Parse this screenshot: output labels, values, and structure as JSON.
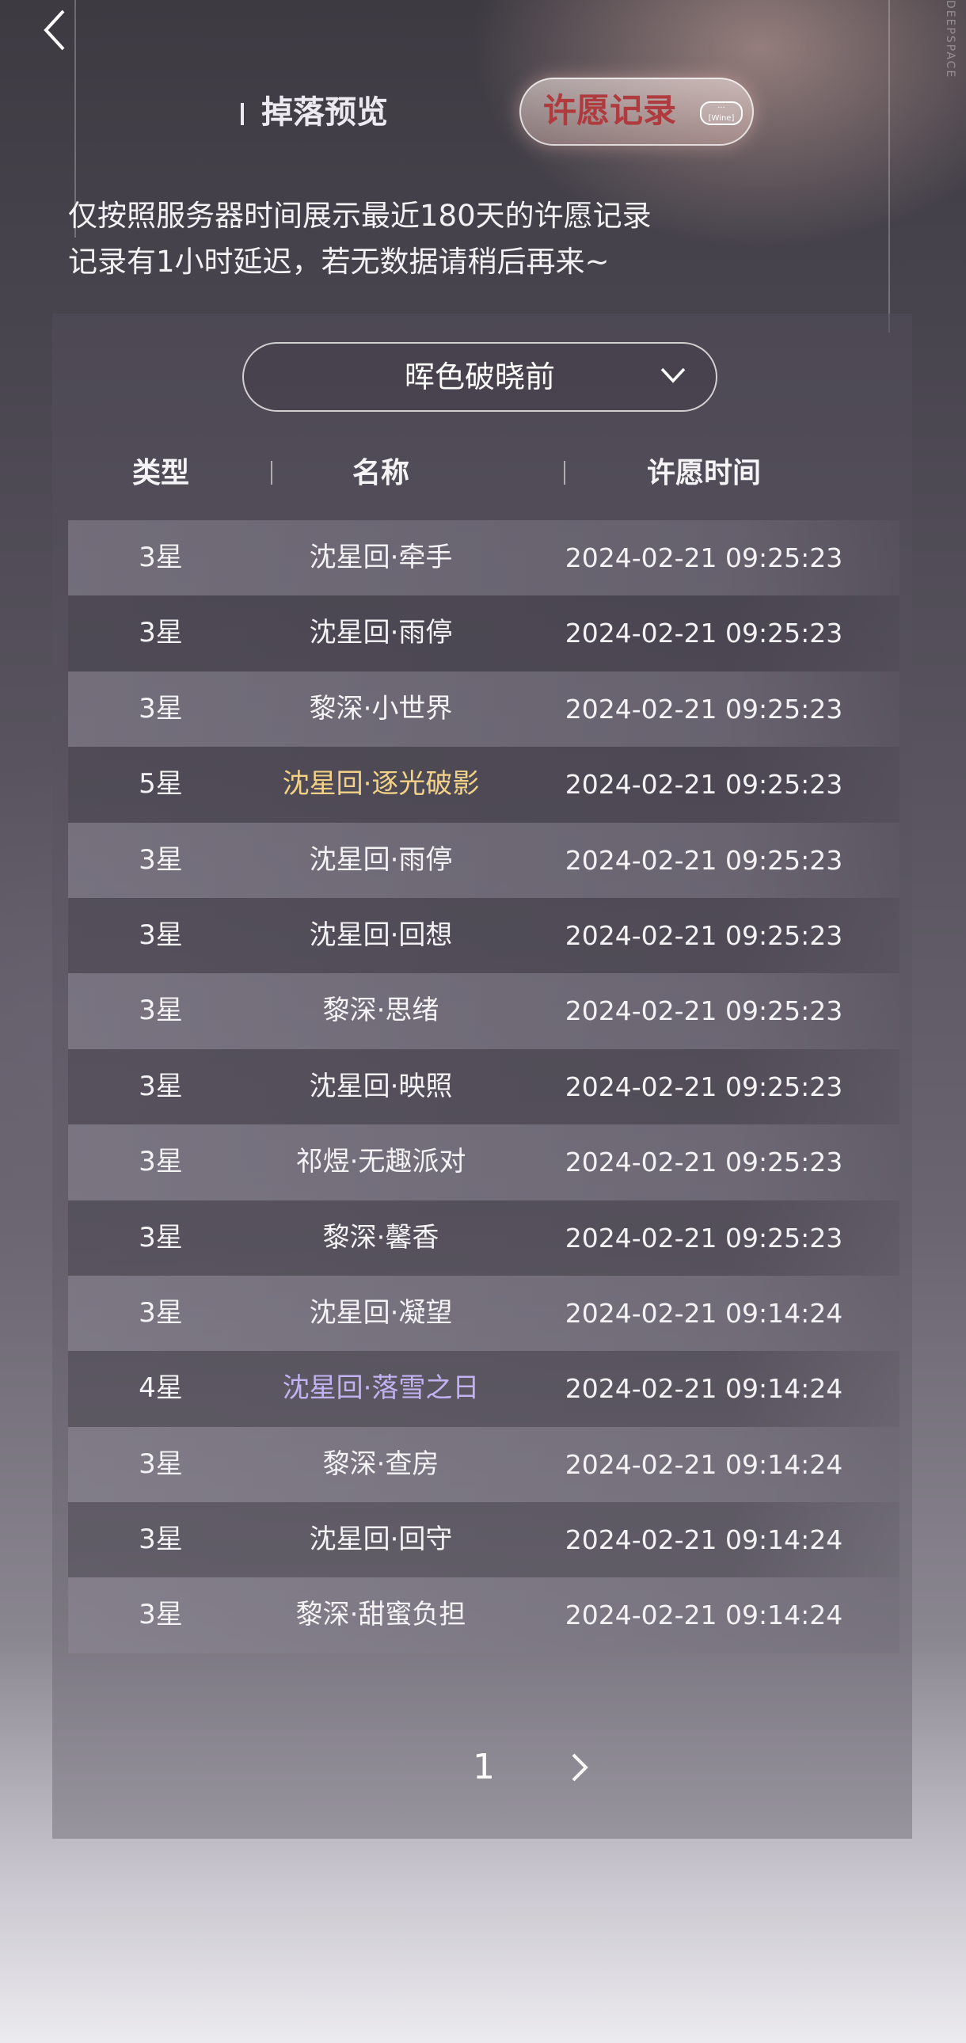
{
  "tabs": {
    "preview": "掉落预览",
    "records": "许愿记录",
    "badge_line1": "···",
    "badge_line2": "[Wine]"
  },
  "notice": {
    "line1": "仅按照服务器时间展示最近180天的许愿记录",
    "line2": "记录有1小时延迟，若无数据请稍后再来~"
  },
  "pool_select": {
    "value": "晖色破晓前"
  },
  "table": {
    "headers": {
      "type": "类型",
      "name": "名称",
      "time": "许愿时间"
    },
    "rows": [
      {
        "type": "3星",
        "name": "沈星回·牵手",
        "time": "2024-02-21 09:25:23",
        "rarity": "3"
      },
      {
        "type": "3星",
        "name": "沈星回·雨停",
        "time": "2024-02-21 09:25:23",
        "rarity": "3"
      },
      {
        "type": "3星",
        "name": "黎深·小世界",
        "time": "2024-02-21 09:25:23",
        "rarity": "3"
      },
      {
        "type": "5星",
        "name": "沈星回·逐光破影",
        "time": "2024-02-21 09:25:23",
        "rarity": "5"
      },
      {
        "type": "3星",
        "name": "沈星回·雨停",
        "time": "2024-02-21 09:25:23",
        "rarity": "3"
      },
      {
        "type": "3星",
        "name": "沈星回·回想",
        "time": "2024-02-21 09:25:23",
        "rarity": "3"
      },
      {
        "type": "3星",
        "name": "黎深·思绪",
        "time": "2024-02-21 09:25:23",
        "rarity": "3"
      },
      {
        "type": "3星",
        "name": "沈星回·映照",
        "time": "2024-02-21 09:25:23",
        "rarity": "3"
      },
      {
        "type": "3星",
        "name": "祁煜·无趣派对",
        "time": "2024-02-21 09:25:23",
        "rarity": "3"
      },
      {
        "type": "3星",
        "name": "黎深·馨香",
        "time": "2024-02-21 09:25:23",
        "rarity": "3"
      },
      {
        "type": "3星",
        "name": "沈星回·凝望",
        "time": "2024-02-21 09:14:24",
        "rarity": "3"
      },
      {
        "type": "4星",
        "name": "沈星回·落雪之日",
        "time": "2024-02-21 09:14:24",
        "rarity": "4"
      },
      {
        "type": "3星",
        "name": "黎深·查房",
        "time": "2024-02-21 09:14:24",
        "rarity": "3"
      },
      {
        "type": "3星",
        "name": "沈星回·回守",
        "time": "2024-02-21 09:14:24",
        "rarity": "3"
      },
      {
        "type": "3星",
        "name": "黎深·甜蜜负担",
        "time": "2024-02-21 09:14:24",
        "rarity": "3"
      }
    ]
  },
  "pager": {
    "current": "1"
  },
  "colors": {
    "five_star": "#f3d287",
    "four_star": "#c3b2f2",
    "active_tab_text": "#b03b3e"
  },
  "icons": {
    "back": "chevron-left-icon",
    "dropdown": "chevron-down-icon",
    "next": "chevron-right-icon"
  }
}
